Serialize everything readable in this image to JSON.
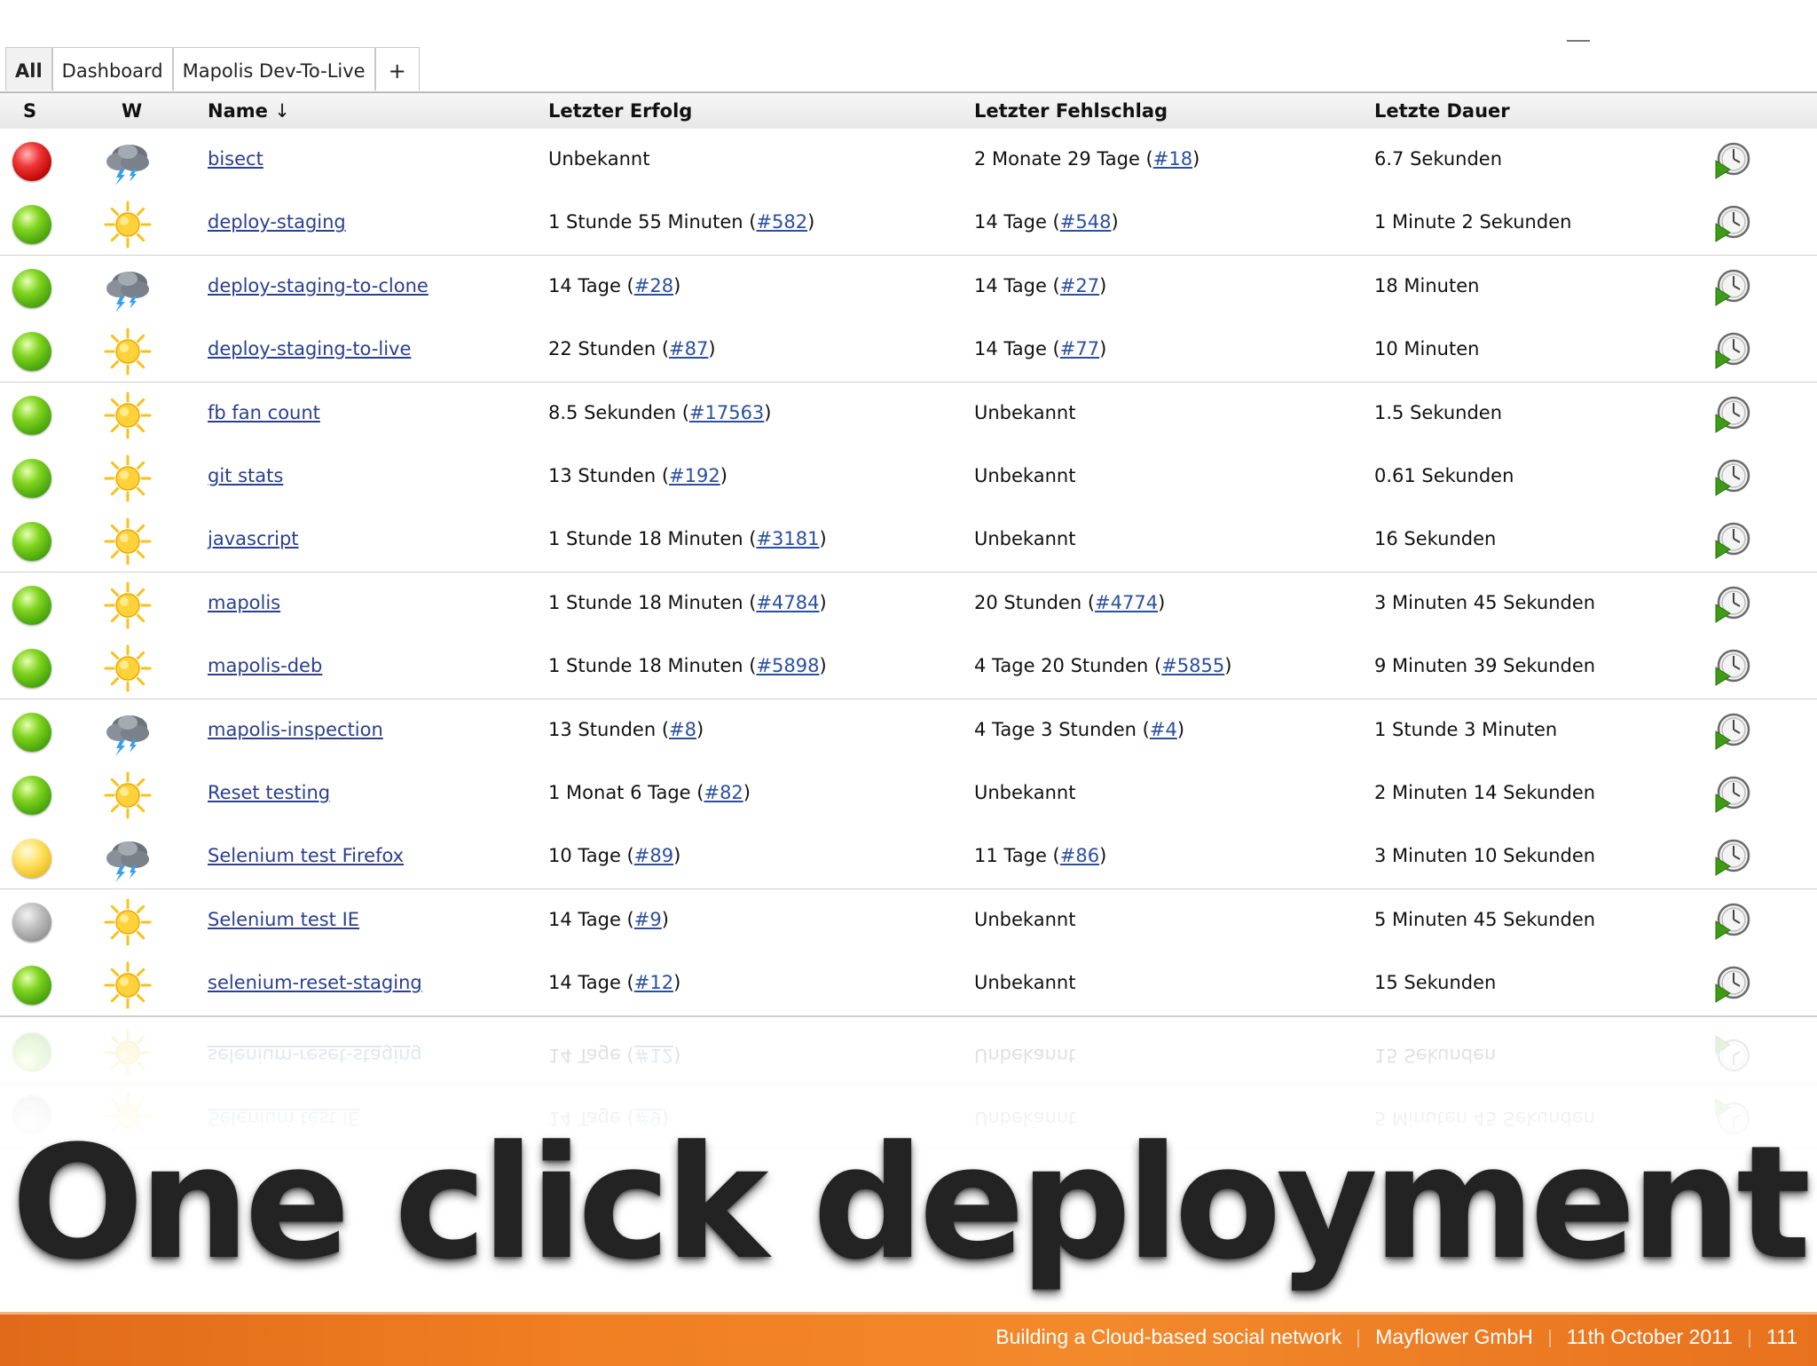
{
  "tabs": [
    "All",
    "Dashboard",
    "Mapolis Dev-To-Live",
    "+"
  ],
  "headers": {
    "s": "S",
    "w": "W",
    "name": "Name",
    "sort_arrow": "↓",
    "last_success": "Letzter Erfolg",
    "last_failure": "Letzter Fehlschlag",
    "last_duration": "Letzte Dauer"
  },
  "jobs": [
    {
      "status": "red",
      "weather": "storm-icon",
      "name": "bisect",
      "success": "Unbekannt",
      "success_link": "",
      "failure": "2 Monate 29 Tage (",
      "failure_link": "#18",
      "duration": "6.7 Sekunden"
    },
    {
      "status": "green",
      "weather": "sun-icon",
      "name": "deploy-staging",
      "success": "1 Stunde 55 Minuten (",
      "success_link": "#582",
      "failure": "14 Tage (",
      "failure_link": "#548",
      "duration": "1 Minute 2 Sekunden"
    },
    {
      "status": "green",
      "weather": "storm-icon",
      "name": "deploy-staging-to-clone",
      "success": "14 Tage (",
      "success_link": "#28",
      "failure": "14 Tage (",
      "failure_link": "#27",
      "duration": "18 Minuten"
    },
    {
      "status": "green",
      "weather": "sun-icon",
      "name": "deploy-staging-to-live",
      "success": "22 Stunden (",
      "success_link": "#87",
      "failure": "14 Tage (",
      "failure_link": "#77",
      "duration": "10 Minuten"
    },
    {
      "status": "green",
      "weather": "sun-icon",
      "name": "fb fan count",
      "success": "8.5 Sekunden (",
      "success_link": "#17563",
      "failure": "Unbekannt",
      "failure_link": "",
      "duration": "1.5 Sekunden"
    },
    {
      "status": "green",
      "weather": "sun-icon",
      "name": "git stats",
      "success": "13 Stunden (",
      "success_link": "#192",
      "failure": "Unbekannt",
      "failure_link": "",
      "duration": "0.61 Sekunden"
    },
    {
      "status": "green",
      "weather": "sun-icon",
      "name": "javascript",
      "success": "1 Stunde 18 Minuten (",
      "success_link": "#3181",
      "failure": "Unbekannt",
      "failure_link": "",
      "duration": "16 Sekunden"
    },
    {
      "status": "green",
      "weather": "sun-icon",
      "name": "mapolis",
      "success": "1 Stunde 18 Minuten (",
      "success_link": "#4784",
      "failure": "20 Stunden (",
      "failure_link": "#4774",
      "duration": "3 Minuten 45 Sekunden"
    },
    {
      "status": "green",
      "weather": "sun-icon",
      "name": "mapolis-deb",
      "success": "1 Stunde 18 Minuten (",
      "success_link": "#5898",
      "failure": "4 Tage 20 Stunden (",
      "failure_link": "#5855",
      "duration": "9 Minuten 39 Sekunden"
    },
    {
      "status": "green",
      "weather": "storm-icon",
      "name": "mapolis-inspection",
      "success": "13 Stunden (",
      "success_link": "#8",
      "failure": "4 Tage 3 Stunden (",
      "failure_link": "#4",
      "duration": "1 Stunde 3 Minuten"
    },
    {
      "status": "green",
      "weather": "sun-icon",
      "name": "Reset testing",
      "success": "1 Monat 6 Tage (",
      "success_link": "#82",
      "failure": "Unbekannt",
      "failure_link": "",
      "duration": "2 Minuten 14 Sekunden"
    },
    {
      "status": "yellow",
      "weather": "storm-icon",
      "name": "Selenium test Firefox",
      "success": "10 Tage (",
      "success_link": "#89",
      "failure": "11 Tage (",
      "failure_link": "#86",
      "duration": "3 Minuten 10 Sekunden"
    },
    {
      "status": "grey",
      "weather": "sun-icon",
      "name": "Selenium test IE",
      "success": "14 Tage (",
      "success_link": "#9",
      "failure": "Unbekannt",
      "failure_link": "",
      "duration": "5 Minuten 45 Sekunden"
    },
    {
      "status": "green",
      "weather": "sun-icon",
      "name": "selenium-reset-staging",
      "success": "14 Tage (",
      "success_link": "#12",
      "failure": "Unbekannt",
      "failure_link": "",
      "duration": "15 Sekunden"
    }
  ],
  "slide_title": "One click deployment",
  "footer": {
    "talk": "Building a Cloud-based social network",
    "company": "Mayflower GmbH",
    "date": "11th October 2011",
    "page": "111"
  },
  "colors": {
    "link": "#2a4fa0",
    "footer_orange": "#f07d21",
    "status_red": "#e02020",
    "status_green": "#5cb818",
    "status_yellow": "#ffd84a",
    "status_grey": "#a8a8a8"
  }
}
